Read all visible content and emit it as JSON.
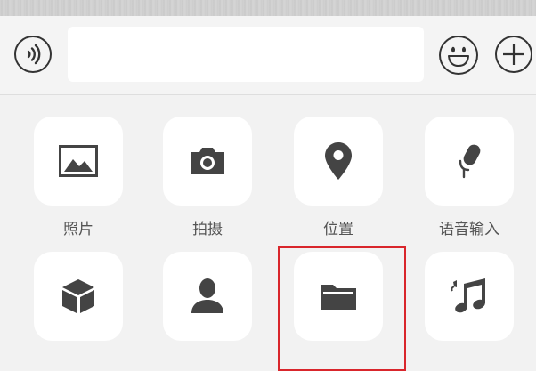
{
  "input": {
    "value": "",
    "placeholder": ""
  },
  "icons": {
    "voice": "voice-wave-icon",
    "emoji": "smiley-face-icon",
    "plus": "plus-circle-icon",
    "photo": "photo-icon",
    "camera": "camera-icon",
    "location": "location-pin-icon",
    "voice_input": "microphone-icon",
    "box": "cube-icon",
    "contact": "person-icon",
    "file": "folder-icon",
    "music": "music-note-icon"
  },
  "panel": {
    "items": [
      {
        "label": "照片"
      },
      {
        "label": "拍摄"
      },
      {
        "label": "位置"
      },
      {
        "label": "语音输入"
      },
      {
        "label": ""
      },
      {
        "label": ""
      },
      {
        "label": ""
      },
      {
        "label": ""
      }
    ]
  },
  "colors": {
    "icon": "#444444",
    "highlight_border": "#d9262c",
    "panel_background": "#f2f2f2",
    "tile_background": "#ffffff"
  }
}
